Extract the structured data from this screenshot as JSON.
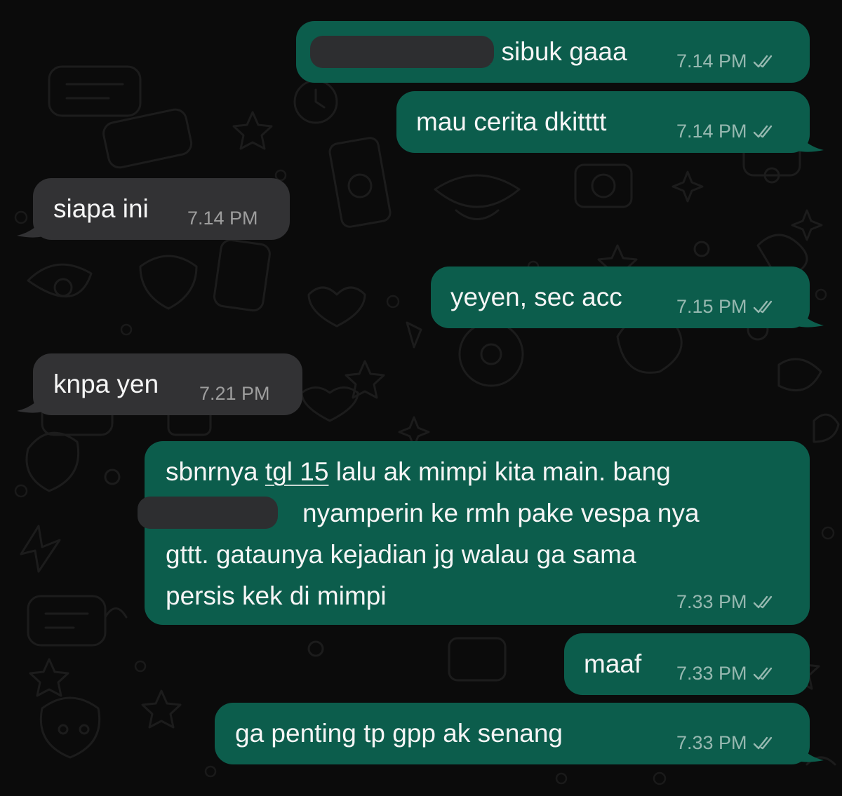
{
  "chat": {
    "messages": [
      {
        "id": 1,
        "direction": "outgoing",
        "text": ", sibuk gaaa",
        "time": "7.14 PM",
        "status_icon": "double-check-icon"
      },
      {
        "id": 2,
        "direction": "outgoing",
        "text": "mau cerita dkitttt",
        "time": "7.14 PM",
        "status_icon": "double-check-icon"
      },
      {
        "id": 3,
        "direction": "incoming",
        "text": "siapa ini",
        "time": "7.14 PM"
      },
      {
        "id": 4,
        "direction": "outgoing",
        "text": "yeyen, sec acc",
        "time": "7.15 PM",
        "status_icon": "double-check-icon"
      },
      {
        "id": 5,
        "direction": "incoming",
        "text": "knpa yen",
        "time": "7.21 PM"
      },
      {
        "id": 6,
        "direction": "outgoing",
        "text_parts": {
          "before_link": "sbnrnya ",
          "link": "tgl 15",
          "after_link": " lalu ak mimpi kita main. bang",
          "line2": "nyamperin ke rmh pake vespa nya",
          "line3": "gttt. gataunya kejadian jg walau ga sama",
          "line4": "persis kek di mimpi"
        },
        "time": "7.33 PM",
        "status_icon": "double-check-icon"
      },
      {
        "id": 7,
        "direction": "outgoing",
        "text": "maaf",
        "time": "7.33 PM",
        "status_icon": "double-check-icon"
      },
      {
        "id": 8,
        "direction": "outgoing",
        "text": "ga penting tp gpp ak senang",
        "time": "7.33 PM",
        "status_icon": "double-check-icon"
      }
    ]
  },
  "colors": {
    "outgoing_bubble": "#0c5d4c",
    "incoming_bubble": "#323234",
    "background": "#0b0b0b",
    "redaction": "#2d2e30"
  }
}
